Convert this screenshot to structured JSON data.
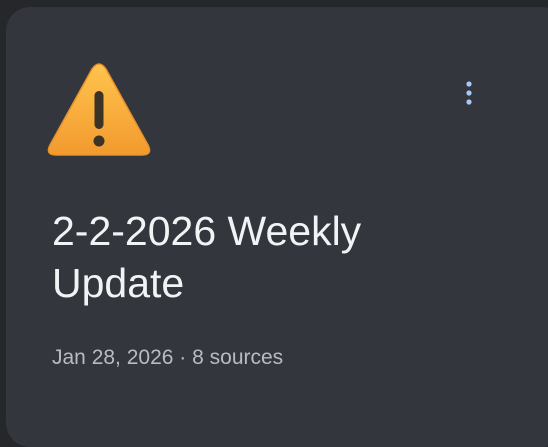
{
  "notebook_card": {
    "emoji": "warning-sign",
    "title": "2-2-2026 Weekly Update",
    "date": "Jan 28, 2026",
    "separator": "·",
    "sources": "8 sources",
    "menu_icon": "more-vert-icon"
  },
  "colors": {
    "page_bg": "#25272b",
    "card_bg": "#33363d",
    "title_text": "#f1f3f4",
    "meta_text": "#b7bcc2",
    "menu_dots": "#a8c7fa",
    "warning_fill": "#f5b342"
  }
}
